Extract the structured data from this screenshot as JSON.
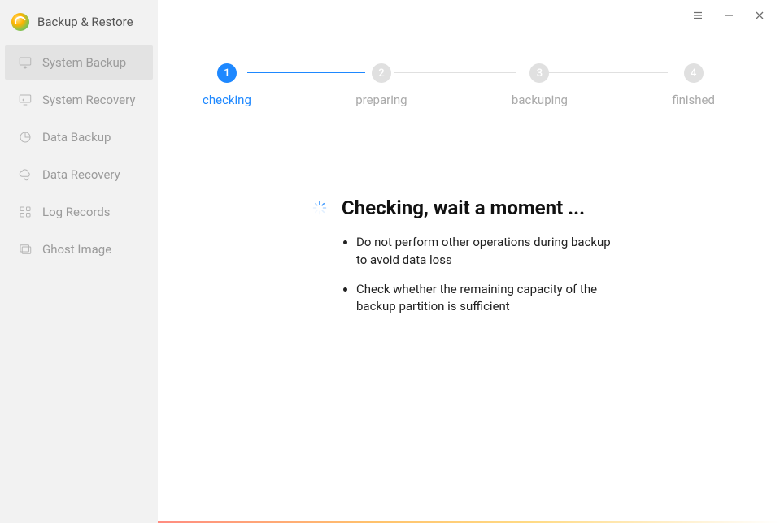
{
  "app": {
    "title": "Backup & Restore"
  },
  "sidebar": {
    "items": [
      {
        "label": "System Backup",
        "icon": "monitor-disk-icon",
        "active": true
      },
      {
        "label": "System Recovery",
        "icon": "monitor-back-icon",
        "active": false
      },
      {
        "label": "Data Backup",
        "icon": "pie-icon",
        "active": false
      },
      {
        "label": "Data Recovery",
        "icon": "cloud-refresh-icon",
        "active": false
      },
      {
        "label": "Log Records",
        "icon": "grid-icon",
        "active": false
      },
      {
        "label": "Ghost Image",
        "icon": "ghost-folder-icon",
        "active": false
      }
    ]
  },
  "steps": [
    {
      "num": "1",
      "label": "checking",
      "state": "active"
    },
    {
      "num": "2",
      "label": "preparing",
      "state": "inactive"
    },
    {
      "num": "3",
      "label": "backuping",
      "state": "inactive"
    },
    {
      "num": "4",
      "label": "finished",
      "state": "inactive"
    }
  ],
  "status": {
    "heading": "Checking, wait a moment ...",
    "bullets": [
      "Do not perform other operations during backup to avoid data loss",
      "Check whether the remaining capacity of the backup partition is sufficient"
    ]
  }
}
